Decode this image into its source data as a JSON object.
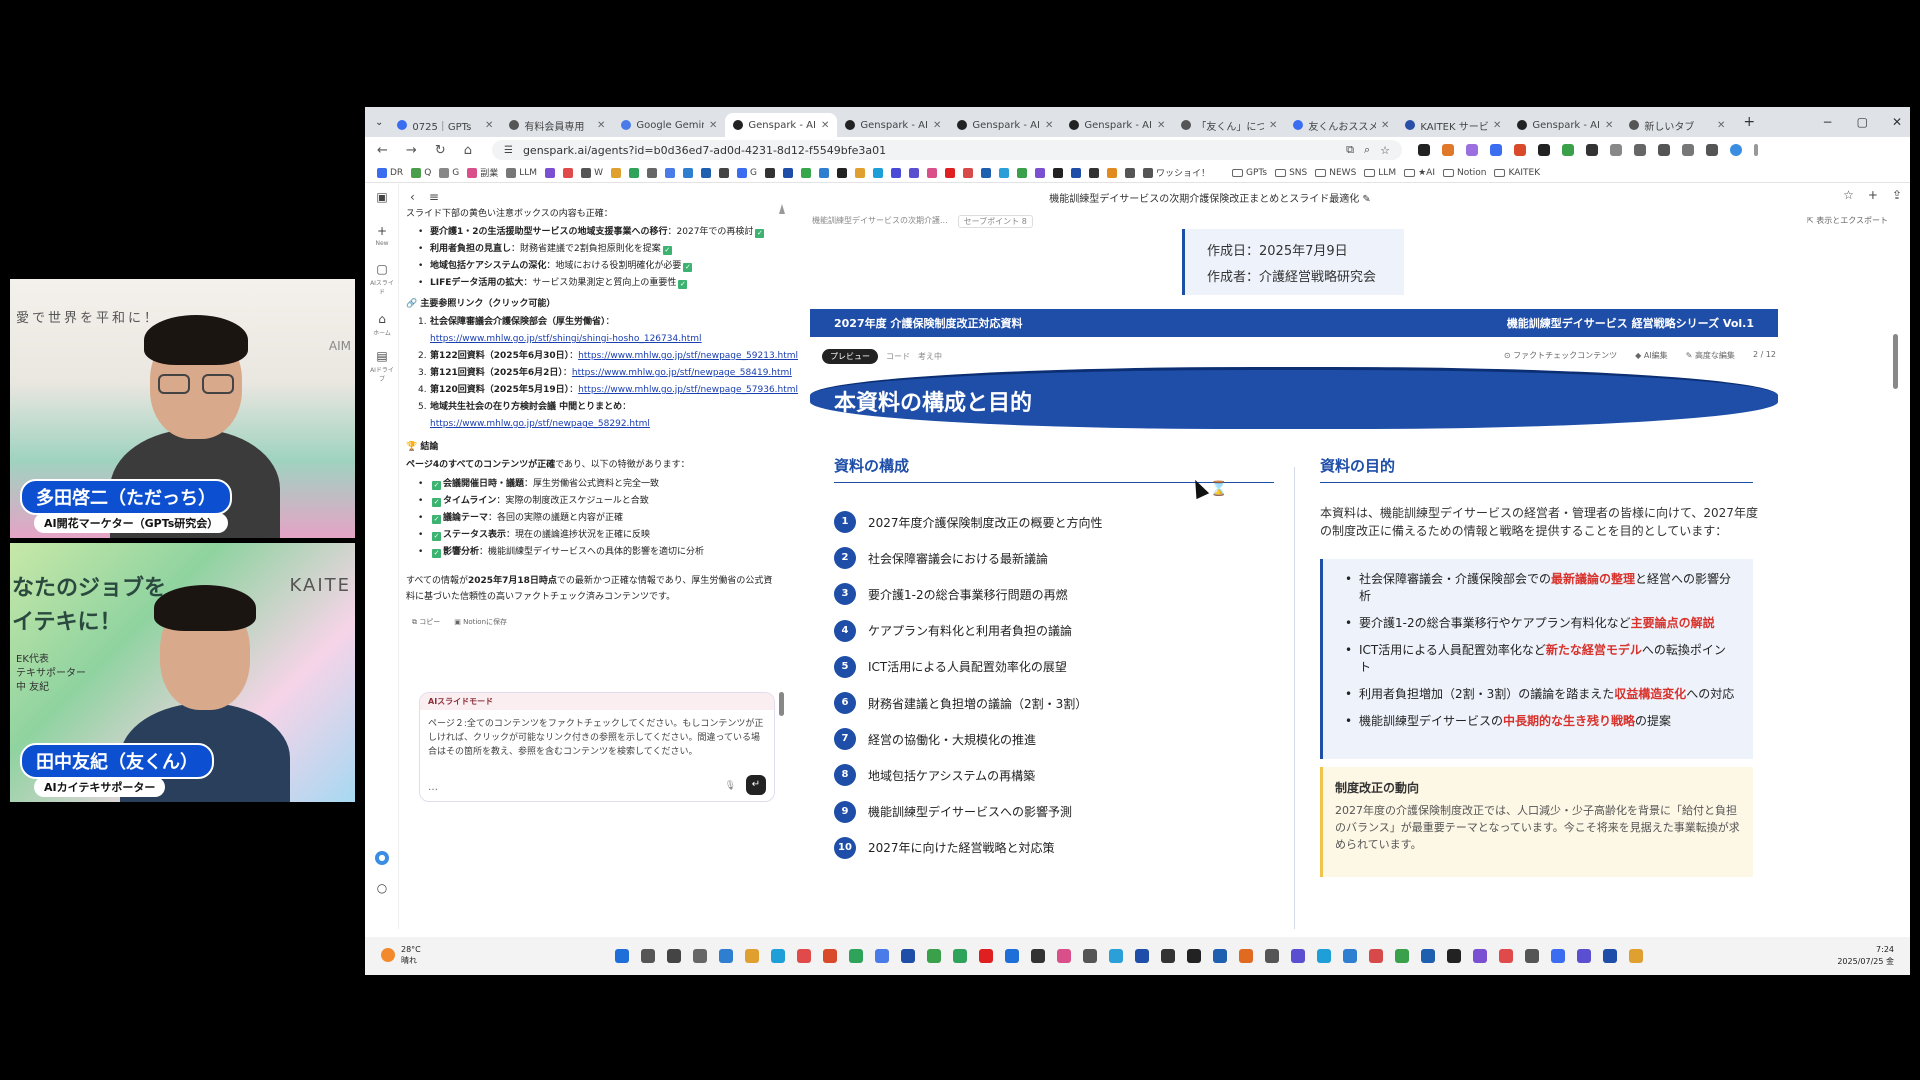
{
  "webcam1": {
    "background_text": "愛で世界を平和に！",
    "brand": "AIM",
    "name": "多田啓二（ただっち）",
    "role": "AI開花マーケター（GPTs研究会）"
  },
  "webcam2": {
    "background_text_line1": "なたのジョブを",
    "background_text_line2": "イテキに！",
    "background_sub": "EK代表\nテキサポーター\n中 友紀",
    "brand": "KAITE",
    "name": "田中友紀（友くん）",
    "role": "AIカイテキサポーター"
  },
  "browser": {
    "tabs": [
      {
        "title": "0725｜GPTs",
        "color": "#3a6df0",
        "active": false
      },
      {
        "title": "有料会員専用",
        "color": "#555555",
        "active": false
      },
      {
        "title": "Google Gemini",
        "color": "#4a7be8",
        "active": false
      },
      {
        "title": "Genspark - AI",
        "color": "#222222",
        "active": true
      },
      {
        "title": "Genspark - AI",
        "color": "#222222",
        "active": false
      },
      {
        "title": "Genspark - AI",
        "color": "#222222",
        "active": false
      },
      {
        "title": "Genspark - AI",
        "color": "#222222",
        "active": false
      },
      {
        "title": "「友くん」につい",
        "color": "#555555",
        "active": false
      },
      {
        "title": "友くんおススメ",
        "color": "#3a6df0",
        "active": false
      },
      {
        "title": "KAITEK サービ",
        "color": "#2a4fa8",
        "active": false
      },
      {
        "title": "Genspark - AI",
        "color": "#222222",
        "active": false
      },
      {
        "title": "新しいタブ",
        "color": "#555555",
        "active": false
      }
    ],
    "url": "genspark.ai/agents?id=b0d36ed7-ad0d-4231-8d12-f5549bfe3a01",
    "bookmarks": [
      {
        "label": "DR",
        "color": "#3a6df0",
        "folder": false
      },
      {
        "label": "Q",
        "color": "#4a9e4a",
        "folder": false
      },
      {
        "label": "G",
        "color": "#888888",
        "folder": false
      },
      {
        "label": "副業",
        "color": "#d94f8a",
        "folder": false
      },
      {
        "label": "LLM",
        "color": "#777777",
        "folder": false
      },
      {
        "label": "",
        "color": "#7a4fd1",
        "folder": false
      },
      {
        "label": "",
        "color": "#e04a4a",
        "folder": false
      },
      {
        "label": "W",
        "color": "#555555",
        "folder": false
      },
      {
        "label": "",
        "color": "#e0a030",
        "folder": false
      },
      {
        "label": "",
        "color": "#2fa35a",
        "folder": false
      },
      {
        "label": "",
        "color": "#666666",
        "folder": false
      },
      {
        "label": "",
        "color": "#4a7be8",
        "folder": false
      },
      {
        "label": "",
        "color": "#2f7fd1",
        "folder": false
      },
      {
        "label": "",
        "color": "#1f5fb0",
        "folder": false
      },
      {
        "label": "",
        "color": "#444444",
        "folder": false
      },
      {
        "label": "G",
        "color": "#3a6df0",
        "folder": false
      },
      {
        "label": "",
        "color": "#333333",
        "folder": false
      },
      {
        "label": "",
        "color": "#1e4ea8",
        "folder": false
      },
      {
        "label": "",
        "color": "#36a84a",
        "folder": false
      },
      {
        "label": "",
        "color": "#2f7fd1",
        "folder": false
      },
      {
        "label": "",
        "color": "#222222",
        "folder": false
      },
      {
        "label": "",
        "color": "#e0a030",
        "folder": false
      },
      {
        "label": "",
        "color": "#1f9fd8",
        "folder": false
      },
      {
        "label": "",
        "color": "#4a4ad8",
        "folder": false
      },
      {
        "label": "",
        "color": "#5a4fd1",
        "folder": false
      },
      {
        "label": "",
        "color": "#d94f8a",
        "folder": false
      },
      {
        "label": "",
        "color": "#e02020",
        "folder": false
      },
      {
        "label": "",
        "color": "#d84a4a",
        "folder": false
      },
      {
        "label": "",
        "color": "#1f5fb0",
        "folder": false
      },
      {
        "label": "",
        "color": "#2a9fd8",
        "folder": false
      },
      {
        "label": "",
        "color": "#3aa04a",
        "folder": false
      },
      {
        "label": "",
        "color": "#7a4fd1",
        "folder": false
      },
      {
        "label": "",
        "color": "#222222",
        "folder": false
      },
      {
        "label": "",
        "color": "#1e4ea8",
        "folder": false
      },
      {
        "label": "",
        "color": "#333333",
        "folder": false
      },
      {
        "label": "",
        "color": "#e08a20",
        "folder": false
      },
      {
        "label": "",
        "color": "#555555",
        "folder": false
      },
      {
        "label": "ワッショイ！",
        "color": "#555555",
        "folder": false
      },
      {
        "label": "GPTs",
        "color": "",
        "folder": true
      },
      {
        "label": "SNS",
        "color": "",
        "folder": true
      },
      {
        "label": "NEWS",
        "color": "",
        "folder": true
      },
      {
        "label": "LLM",
        "color": "",
        "folder": true
      },
      {
        "label": "★AI",
        "color": "",
        "folder": true
      },
      {
        "label": "Notion",
        "color": "",
        "folder": true
      },
      {
        "label": "KAITEK",
        "color": "",
        "folder": true
      }
    ]
  },
  "rail": {
    "new_label": "New",
    "slides_label": "AIスライド",
    "home_label": "ホーム",
    "drive_label": "AIドライブ"
  },
  "chat": {
    "intro": "スライド下部の黄色い注意ボックスの内容も正確：",
    "checks": [
      {
        "bold": "要介護1・2の生活援助型サービスの地域支援事業への移行",
        "text": "：2027年での再検討"
      },
      {
        "bold": "利用者負担の見直し",
        "text": "：財務省建議で2割負担原則化を提案"
      },
      {
        "bold": "地域包括ケアシステムの深化",
        "text": "：地域における役割明確化が必要"
      },
      {
        "bold": "LIFEデータ活用の拡大",
        "text": "：サービス効果測定と質向上の重要性"
      }
    ],
    "links_title": "主要参照リンク（クリック可能）",
    "links": [
      {
        "num": "1.",
        "label": "社会保障審議会介護保険部会（厚生労働省）",
        "url": "https://www.mhlw.go.jp/stf/shingi/shingi-hosho_126734.html",
        "wrap": true
      },
      {
        "num": "2.",
        "label": "第122回資料（2025年6月30日）",
        "url": "https://www.mhlw.go.jp/stf/newpage_59213.html",
        "wrap": false
      },
      {
        "num": "3.",
        "label": "第121回資料（2025年6月2日）",
        "url": "https://www.mhlw.go.jp/stf/newpage_58419.html",
        "wrap": false
      },
      {
        "num": "4.",
        "label": "第120回資料（2025年5月19日）",
        "url": "https://www.mhlw.go.jp/stf/newpage_57936.html",
        "wrap": false
      },
      {
        "num": "5.",
        "label": "地域共生社会の在り方検討会議 中間とりまとめ",
        "url": "https://www.mhlw.go.jp/stf/newpage_58292.html",
        "wrap": true
      }
    ],
    "conclusion_title": "結論",
    "conclusion_lead_bold": "ページ4のすべてのコンテンツが正確",
    "conclusion_lead_rest": "であり、以下の特徴があります：",
    "features": [
      {
        "bold": "会議開催日時・議題",
        "text": "：厚生労働省公式資料と完全一致"
      },
      {
        "bold": "タイムライン",
        "text": "：実際の制度改正スケジュールと合致"
      },
      {
        "bold": "議論テーマ",
        "text": "：各回の実際の議題と内容が正確"
      },
      {
        "bold": "ステータス表示",
        "text": "：現在の議論進捗状況を正確に反映"
      },
      {
        "bold": "影響分析",
        "text": "：機能訓練型デイサービスへの具体的影響を適切に分析"
      }
    ],
    "summary_pre": "すべての情報が",
    "summary_bold": "2025年7月18日時点",
    "summary_post": "での最新かつ正確な情報であり、厚生労働省の公式資料に基づいた信頼性の高いファクトチェック済みコンテンツです。",
    "copy_label": "コピー",
    "notion_label": "Notionに保存",
    "composer_mode": "AIスライドモード",
    "composer_text": "ページ２:全てのコンテンツをファクトチェックしてください。もしコンテンツが正しければ、クリックが可能なリンク付きの参照を示してください。間違っている場合はその箇所を教え、参照を含むコンテンツを検索してください。",
    "composer_more": "…",
    "send_icon": "↵"
  },
  "doc": {
    "title": "機能訓練型デイサービスの次期介護保険改正まとめとスライド最適化",
    "crumb": "機能訓練型デイサービスの次期介護...",
    "savepoint": "セーブポイント 8",
    "export": "表示とエクスポート",
    "created_date": "作成日：2025年7月9日",
    "author": "作成者：介護経営戦略研究会",
    "banner_left": "2027年度 介護保険制度改正対応資料",
    "banner_right": "機能訓練型デイサービス 経営戦略シリーズ Vol.1",
    "view_preview": "プレビュー",
    "view_code": "コード",
    "view_think": "考え中",
    "tool_factcheck": "ファクトチェックコンテンツ",
    "tool_aiedit": "AI編集",
    "tool_advanced": "高度な編集",
    "page_indicator": "2 / 12",
    "slide_title": "本資料の構成と目的",
    "left_heading": "資料の構成",
    "items": [
      "2027年度介護保険制度改正の概要と方向性",
      "社会保障審議会における最新議論",
      "要介護1-2の総合事業移行問題の再燃",
      "ケアプラン有料化と利用者負担の議論",
      "ICT活用による人員配置効率化の展望",
      "財務省建議と負担増の議論（2割・3割）",
      "経営の協働化・大規模化の推進",
      "地域包括ケアシステムの再構築",
      "機能訓練型デイサービスへの影響予測",
      "2027年に向けた経営戦略と対応策"
    ],
    "right_heading": "資料の目的",
    "purpose": "本資料は、機能訓練型デイサービスの経営者・管理者の皆様に向けて、2027年度の制度改正に備えるための情報と戦略を提供することを目的としています：",
    "bullets": [
      {
        "pre": "社会保障審議会・介護保険部会での",
        "red": "最新議論の整理",
        "post": "と経営への影響分析"
      },
      {
        "pre": "要介護1-2の総合事業移行やケアプラン有料化など",
        "red": "主要論点の解説",
        "post": ""
      },
      {
        "pre": "ICT活用による人員配置効率化など",
        "red": "新たな経営モデル",
        "post": "への転換ポイント"
      },
      {
        "pre": "利用者負担増加（2割・3割）の議論を踏まえた",
        "red": "収益構造変化",
        "post": "への対応"
      },
      {
        "pre": "機能訓練型デイサービスの",
        "red": "中長期的な生き残り戦略",
        "post": "の提案"
      }
    ],
    "trend_title": "制度改正の動向",
    "trend_text": "2027年度の介護保険制度改正では、人口減少・少子高齢化を背景に「給付と負担のバランス」が最重要テーマとなっています。今こそ将来を見据えた事業転換が求められています。"
  },
  "taskbar": {
    "temperature": "28°C",
    "weather": "晴れ",
    "time": "7:24",
    "date": "2025/07/25 金",
    "icons": [
      "#1f6fd8",
      "#555555",
      "#444444",
      "#666666",
      "#2f7fd1",
      "#e0a030",
      "#1f9fd8",
      "#e04a4a",
      "#d84a2a",
      "#2fa35a",
      "#4a7be8",
      "#1e4ea8",
      "#3aa04a",
      "#2fa35a",
      "#e02020",
      "#1f6fd8",
      "#333333",
      "#d94f8a",
      "#555555",
      "#2a9fd8",
      "#1e4ea8",
      "#333333",
      "#222222",
      "#1f5fb0",
      "#e06a20",
      "#555555",
      "#5a4fd1",
      "#1f9fd8",
      "#2f7fd1",
      "#d84a4a",
      "#3aa04a",
      "#1f5fb0",
      "#222222",
      "#7a4fd1",
      "#e04a4a",
      "#555555",
      "#3a6df0",
      "#5a4fd1",
      "#1e4ea8",
      "#e0a030"
    ]
  },
  "colors": {
    "accent": "#1e4ea8",
    "highlight_red": "#d8322c",
    "check_green": "#3cb371"
  }
}
